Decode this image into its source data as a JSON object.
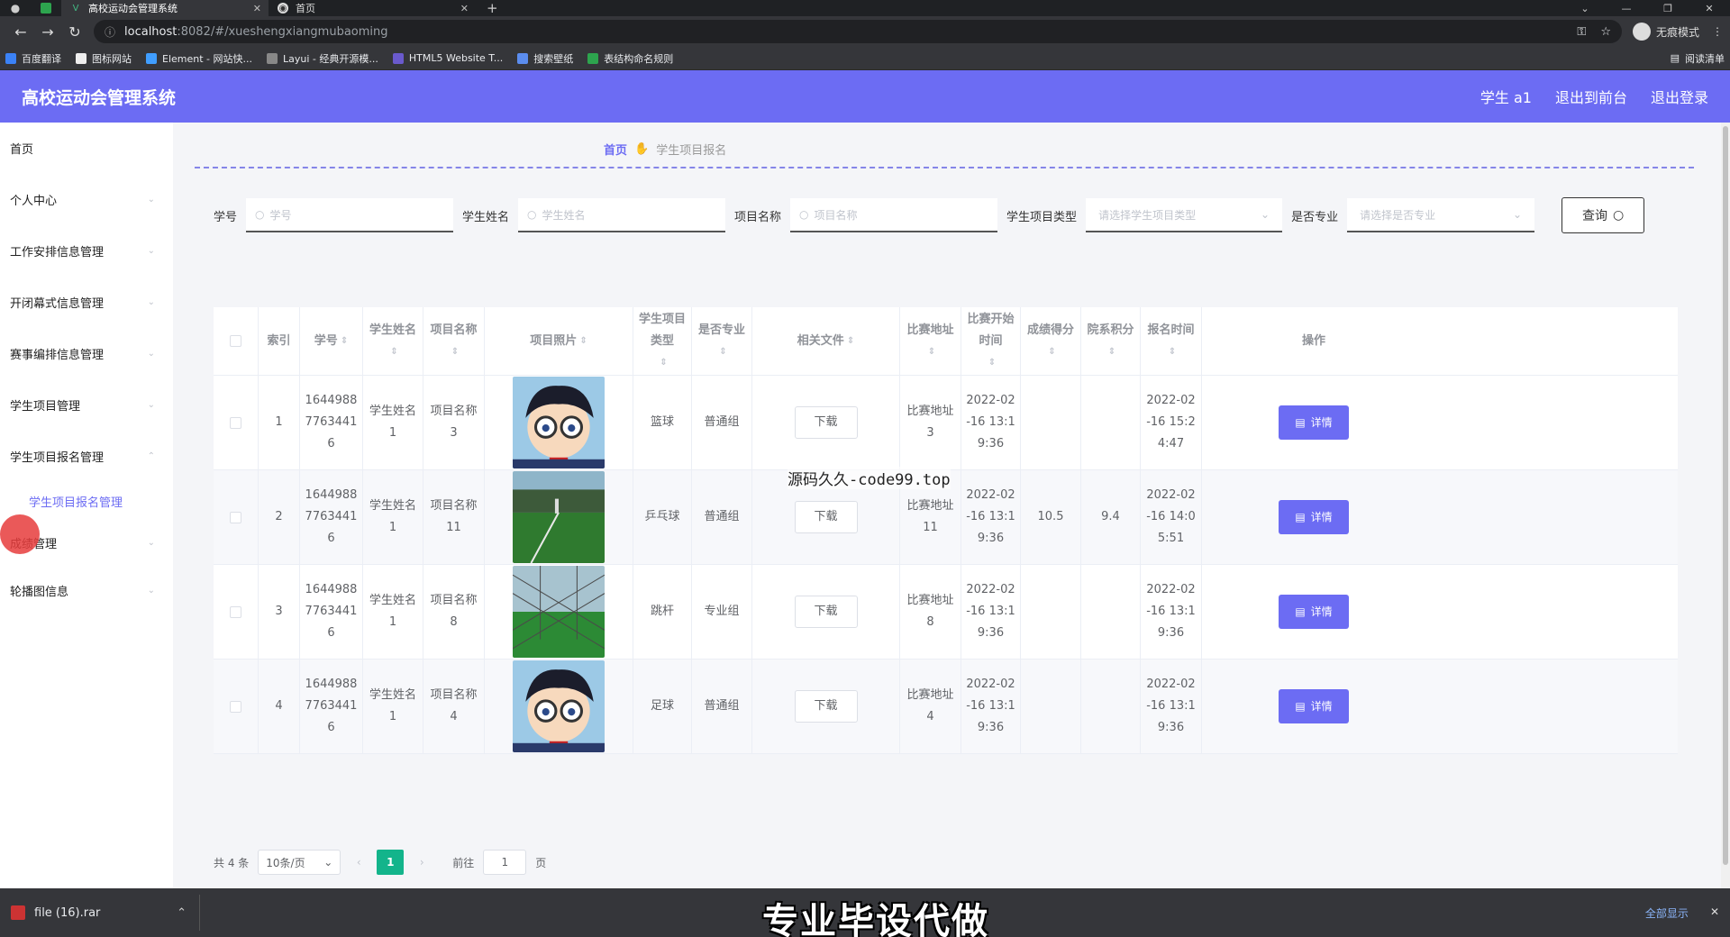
{
  "browser": {
    "tabs": [
      {
        "title": "高校运动会管理系统",
        "active": true
      },
      {
        "title": "首页",
        "active": false
      }
    ],
    "url_host": "localhost",
    "url_rest": ":8082/#/xueshengxiangmubaoming",
    "incognito_label": "无痕模式",
    "bookmarks": [
      "百度翻译",
      "图标网站",
      "Element - 网站快...",
      "Layui - 经典开源模...",
      "HTML5 Website T...",
      "搜索壁纸",
      "表结构命名规则"
    ],
    "reading_list": "阅读清单"
  },
  "header": {
    "title": "高校运动会管理系统",
    "user": "学生 a1",
    "links": [
      "退出到前台",
      "退出登录"
    ]
  },
  "sidebar": {
    "items": [
      {
        "label": "首页",
        "arrow": false
      },
      {
        "label": "个人中心",
        "arrow": true
      },
      {
        "label": "工作安排信息管理",
        "arrow": true
      },
      {
        "label": "开闭幕式信息管理",
        "arrow": true
      },
      {
        "label": "赛事编排信息管理",
        "arrow": true
      },
      {
        "label": "学生项目管理",
        "arrow": true
      },
      {
        "label": "学生项目报名管理",
        "arrow": true
      }
    ],
    "sub_item": "学生项目报名管理",
    "items_after": [
      {
        "label": "成绩管理",
        "arrow": true
      },
      {
        "label": "轮播图信息",
        "arrow": true
      }
    ]
  },
  "breadcrumb": {
    "home": "首页",
    "current": "学生项目报名"
  },
  "search": {
    "fields": [
      {
        "label": "学号",
        "placeholder": "学号"
      },
      {
        "label": "学生姓名",
        "placeholder": "学生姓名"
      },
      {
        "label": "项目名称",
        "placeholder": "项目名称"
      }
    ],
    "selects": [
      {
        "label": "学生项目类型",
        "placeholder": "请选择学生项目类型"
      },
      {
        "label": "是否专业",
        "placeholder": "请选择是否专业"
      }
    ],
    "query_label": "查询"
  },
  "table": {
    "headers": [
      "索引",
      "学号",
      "学生姓名",
      "项目名称",
      "项目照片",
      "学生项目类型",
      "是否专业",
      "相关文件",
      "比赛地址",
      "比赛开始时间",
      "成绩得分",
      "院系积分",
      "报名时间",
      "操作"
    ],
    "rows": [
      {
        "index": "1",
        "student_no": "1644988\n7763441\n6",
        "name": "学生姓名\n1",
        "project": "项目名称\n3",
        "photo": "cartoon",
        "type": "篮球",
        "pro": "普通组",
        "file": "下载",
        "address": "比赛地址\n3",
        "start": "2022-02\n-16 13:1\n9:36",
        "score": "",
        "points": "",
        "signup": "2022-02\n-16 15:2\n4:47",
        "action": "详情"
      },
      {
        "index": "2",
        "student_no": "1644988\n7763441\n6",
        "name": "学生姓名\n1",
        "project": "项目名称\n11",
        "photo": "field",
        "type": "乒乓球",
        "pro": "普通组",
        "file": "下载",
        "address": "比赛地址\n11",
        "start": "2022-02\n-16 13:1\n9:36",
        "score": "10.5",
        "points": "9.4",
        "signup": "2022-02\n-16 14:0\n5:51",
        "action": "详情"
      },
      {
        "index": "3",
        "student_no": "1644988\n7763441\n6",
        "name": "学生姓名\n1",
        "project": "项目名称\n8",
        "photo": "fence",
        "type": "跳杆",
        "pro": "专业组",
        "file": "下载",
        "address": "比赛地址\n8",
        "start": "2022-02\n-16 13:1\n9:36",
        "score": "",
        "points": "",
        "signup": "2022-02\n-16 13:1\n9:36",
        "action": "详情"
      },
      {
        "index": "4",
        "student_no": "1644988\n7763441\n6",
        "name": "学生姓名\n1",
        "project": "项目名称\n4",
        "photo": "cartoon",
        "type": "足球",
        "pro": "普通组",
        "file": "下载",
        "address": "比赛地址\n4",
        "start": "2022-02\n-16 13:1\n9:36",
        "score": "",
        "points": "",
        "signup": "2022-02\n-16 13:1\n9:36",
        "action": "详情"
      }
    ]
  },
  "pagination": {
    "total": "共 4 条",
    "page_size": "10条/页",
    "current_page": "1",
    "goto_label": "前往",
    "goto_value": "1",
    "page_suffix": "页"
  },
  "overlay_text": "源码久久-code99.top",
  "downloads": {
    "file": "file (16).rar",
    "promo": "专业毕设代做",
    "show_all": "全部显示"
  },
  "colors": {
    "accent": "#6c6cf3",
    "pager_active": "#13b48b"
  }
}
